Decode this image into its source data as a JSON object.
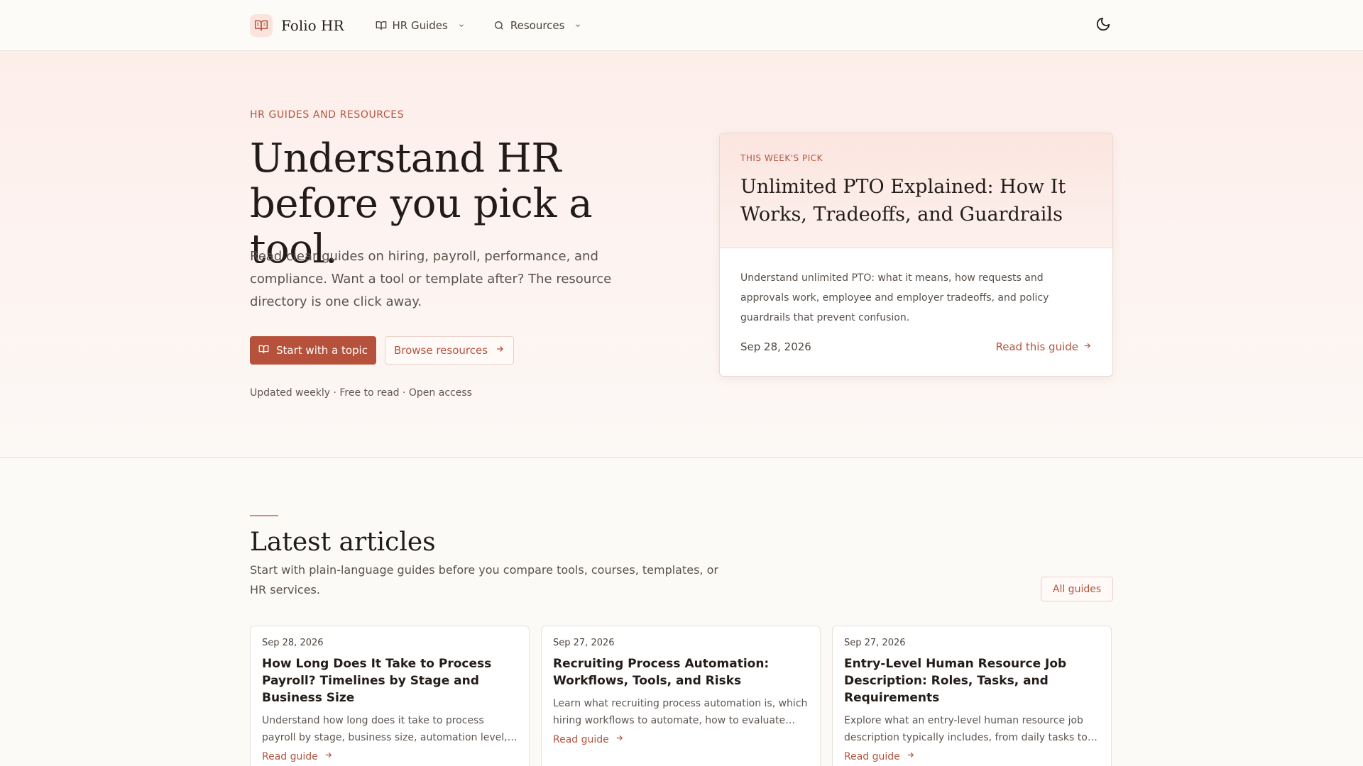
{
  "header": {
    "brand": "Folio HR",
    "nav": [
      {
        "label": "HR Guides",
        "icon": "book-open-icon"
      },
      {
        "label": "Resources",
        "icon": "search-icon"
      }
    ],
    "theme_toggle_icon": "moon-icon"
  },
  "hero": {
    "eyebrow": "HR GUIDES AND RESOURCES",
    "title_line1": "Understand HR",
    "title_line2": "before you pick a tool.",
    "subtitle": "Read clear guides on hiring, payroll, performance, and compliance. Want a tool or template after? The resource directory is one click away.",
    "primary_cta": "Start with a topic",
    "secondary_cta": "Browse resources",
    "meta": "Updated weekly · Free to read · Open access"
  },
  "pick": {
    "eyebrow": "THIS WEEK'S PICK",
    "title": "Unlimited PTO Explained: How It Works, Tradeoffs, and Guardrails",
    "description": "Understand unlimited PTO: what it means, how requests and approvals work, employee and employer tradeoffs, and policy guardrails that prevent confusion.",
    "date": "Sep 28, 2026",
    "link": "Read this guide"
  },
  "latest": {
    "title": "Latest articles",
    "subtitle": "Start with plain-language guides before you compare tools, courses, templates, or HR services.",
    "all_guides": "All guides",
    "articles": [
      {
        "date": "Sep 28, 2026",
        "title": "How Long Does It Take to Process Payroll? Timelines by Stage and Business Size",
        "excerpt": "Understand how long does it take to process payroll by stage, business size, automation level, and more.",
        "link": "Read guide"
      },
      {
        "date": "Sep 27, 2026",
        "title": "Recruiting Process Automation: Workflows, Tools, and Risks",
        "excerpt": "Learn what recruiting process automation is, which hiring workflows to automate, how to evaluate tools, and more.",
        "link": "Read guide"
      },
      {
        "date": "Sep 27, 2026",
        "title": "Entry-Level Human Resource Job Description: Roles, Tasks, and Requirements",
        "excerpt": "Explore what an entry-level human resource job description typically includes, from daily tasks to requirements.",
        "link": "Read guide"
      }
    ]
  },
  "colors": {
    "accent": "#b6523c",
    "hero_bg": "#fdeeea",
    "page_bg": "#fcfaf7"
  }
}
